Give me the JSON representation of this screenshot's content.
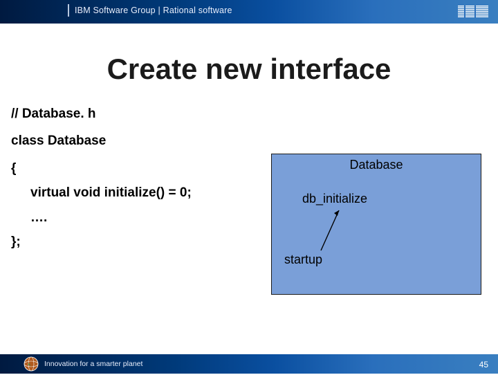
{
  "header": {
    "breadcrumb": "IBM Software Group | Rational software"
  },
  "title": "Create new interface",
  "code": {
    "line1": "// Database. h",
    "line2": "class Database",
    "line3": "{",
    "line4": "virtual void initialize() = 0;",
    "line5": "….",
    "line6": "};"
  },
  "diagram": {
    "title": "Database",
    "node1": "db_initialize",
    "node2": "startup"
  },
  "footer": {
    "tagline": "Innovation for a smarter planet",
    "page": "45"
  }
}
